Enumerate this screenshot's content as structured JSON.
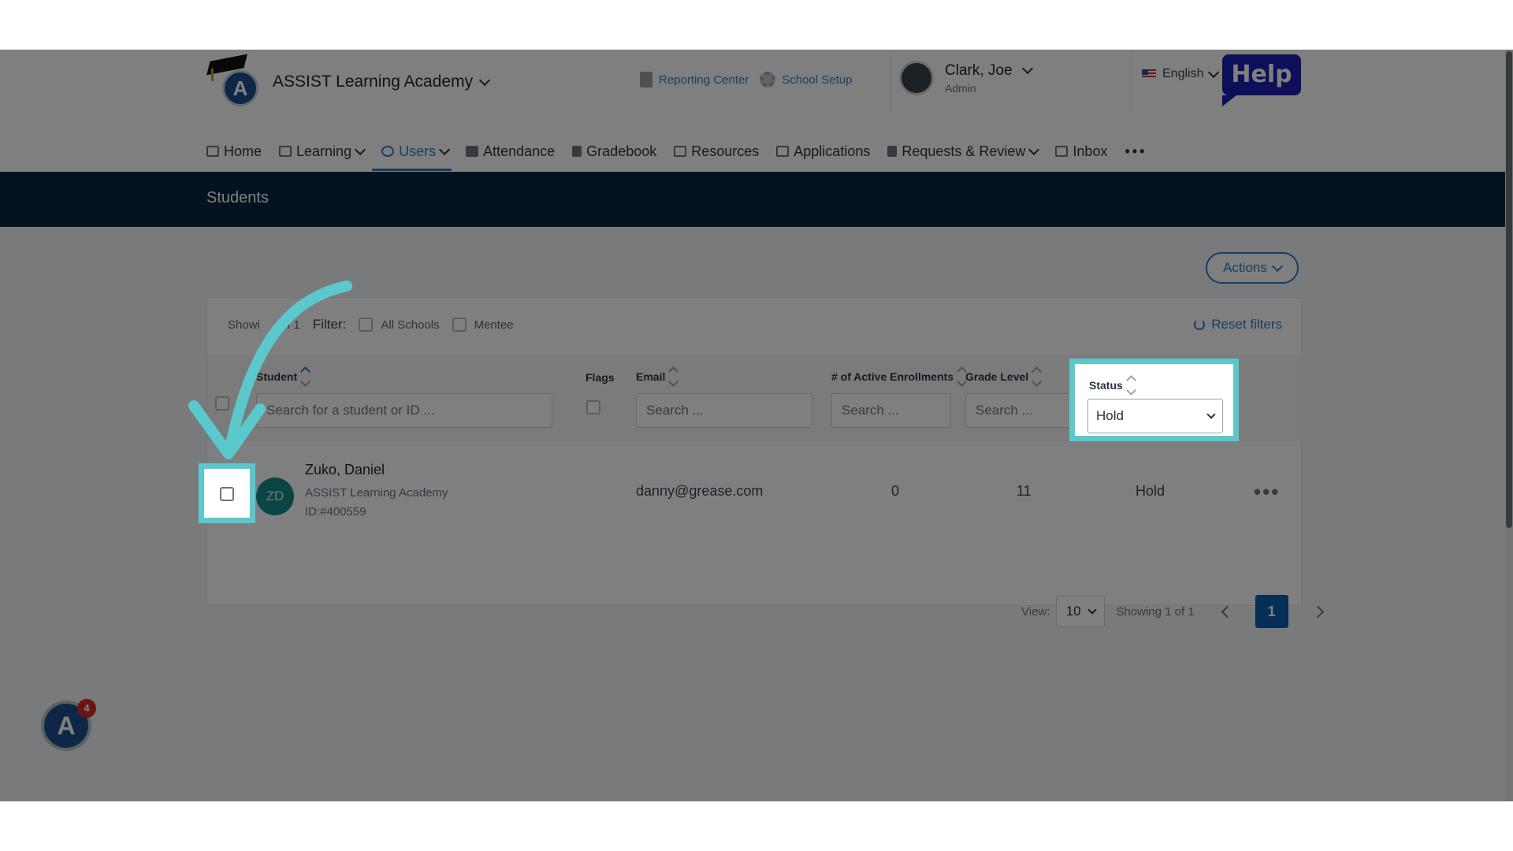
{
  "header": {
    "school_name": "ASSIST Learning Academy",
    "links": [
      {
        "label": "Reporting Center",
        "icon": "document-icon"
      },
      {
        "label": "School Setup",
        "icon": "gear-icon"
      }
    ],
    "user": {
      "name": "Clark, Joe",
      "role": "Admin"
    },
    "language": "English",
    "help_label": "Help"
  },
  "nav": {
    "items": [
      {
        "label": "Home",
        "icon": "home-icon"
      },
      {
        "label": "Learning",
        "icon": "grid-icon"
      },
      {
        "label": "Users",
        "icon": "user-icon"
      },
      {
        "label": "Attendance",
        "icon": "bars-icon"
      },
      {
        "label": "Gradebook",
        "icon": "book-icon"
      },
      {
        "label": "Resources",
        "icon": "tray-icon"
      },
      {
        "label": "Applications",
        "icon": "chat-icon"
      },
      {
        "label": "Requests & Review",
        "icon": "clipboard-icon"
      },
      {
        "label": "Inbox",
        "icon": "mail-icon"
      }
    ],
    "more": "•••"
  },
  "page": {
    "title": "Students",
    "actions_label": "Actions"
  },
  "filters": {
    "showing_a": "Showi",
    "showing_b": "of 1",
    "filter_label": "Filter:",
    "all_schools": "All Schools",
    "mentee": "Mentee",
    "reset": "Reset filters"
  },
  "table": {
    "headers": {
      "student": "Student",
      "flags": "Flags",
      "email": "Email",
      "enrollments": "# of Active Enrollments",
      "grade": "Grade Level",
      "status": "Status"
    },
    "placeholders": {
      "student": "Search for a student or ID ...",
      "email": "Search ...",
      "enrollments": "Search ...",
      "grade": "Search ..."
    },
    "status_filter": "Hold",
    "rows": [
      {
        "initials": "ZD",
        "name": "Zuko, Daniel",
        "school": "ASSIST Learning Academy",
        "id": "ID:#400559",
        "email": "danny@grease.com",
        "enrollments": "0",
        "grade": "11",
        "status": "Hold"
      }
    ]
  },
  "pagination": {
    "view_label": "View:",
    "per_page": "10",
    "showing": "Showing 1 of 1",
    "current_page": "1"
  },
  "widget": {
    "notification_count": "4"
  },
  "colors": {
    "accent": "#2f7fc4",
    "banner": "#0b2741",
    "highlight": "#5bc8cc",
    "help": "#1b1fb0"
  }
}
